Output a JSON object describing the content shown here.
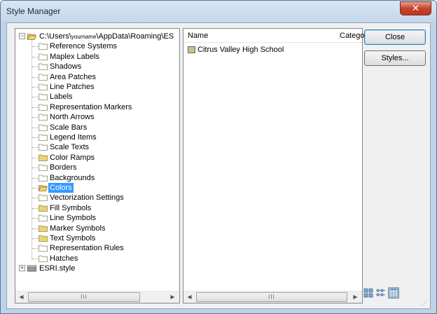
{
  "window": {
    "title": "Style Manager",
    "close_glyph": "✕"
  },
  "tree": {
    "root": {
      "path_prefix": "C:\\Users\\",
      "path_user": "yourname",
      "path_suffix": "\\AppData\\Roaming\\ES",
      "expander": "−"
    },
    "items": [
      {
        "label": "Reference Systems",
        "icon": "folder-empty-icon"
      },
      {
        "label": "Maplex Labels",
        "icon": "folder-empty-icon"
      },
      {
        "label": "Shadows",
        "icon": "folder-empty-icon"
      },
      {
        "label": "Area Patches",
        "icon": "folder-empty-icon"
      },
      {
        "label": "Line Patches",
        "icon": "folder-empty-icon"
      },
      {
        "label": "Labels",
        "icon": "folder-empty-icon"
      },
      {
        "label": "Representation Markers",
        "icon": "folder-empty-icon"
      },
      {
        "label": "North Arrows",
        "icon": "folder-empty-icon"
      },
      {
        "label": "Scale Bars",
        "icon": "folder-empty-icon"
      },
      {
        "label": "Legend Items",
        "icon": "folder-empty-icon"
      },
      {
        "label": "Scale Texts",
        "icon": "folder-empty-icon"
      },
      {
        "label": "Color Ramps",
        "icon": "folder-filled-icon"
      },
      {
        "label": "Borders",
        "icon": "folder-empty-icon"
      },
      {
        "label": "Backgrounds",
        "icon": "folder-empty-icon"
      },
      {
        "label": "Colors",
        "icon": "folder-open-icon",
        "selected": true
      },
      {
        "label": "Vectorization Settings",
        "icon": "folder-empty-icon"
      },
      {
        "label": "Fill Symbols",
        "icon": "folder-filled-icon"
      },
      {
        "label": "Line Symbols",
        "icon": "folder-empty-icon"
      },
      {
        "label": "Marker Symbols",
        "icon": "folder-filled-icon"
      },
      {
        "label": "Text Symbols",
        "icon": "folder-filled-icon"
      },
      {
        "label": "Representation Rules",
        "icon": "folder-empty-icon"
      },
      {
        "label": "Hatches",
        "icon": "folder-empty-icon"
      }
    ],
    "second_root": {
      "label": "ESRI.style",
      "expander": "+"
    }
  },
  "list": {
    "columns": {
      "name": "Name",
      "category": "Catego"
    },
    "items": [
      {
        "label": "Citrus Valley High School",
        "swatch_color": "#c9c08c"
      }
    ]
  },
  "buttons": {
    "close": "Close",
    "styles": "Styles..."
  },
  "scrollbar": {
    "left_arrow": "◀",
    "right_arrow": "▶",
    "thumb_grip": "III"
  },
  "colors": {
    "selection": "#3399ff",
    "folder_filled": "#f2d36b",
    "folder_empty": "#ffffff"
  }
}
